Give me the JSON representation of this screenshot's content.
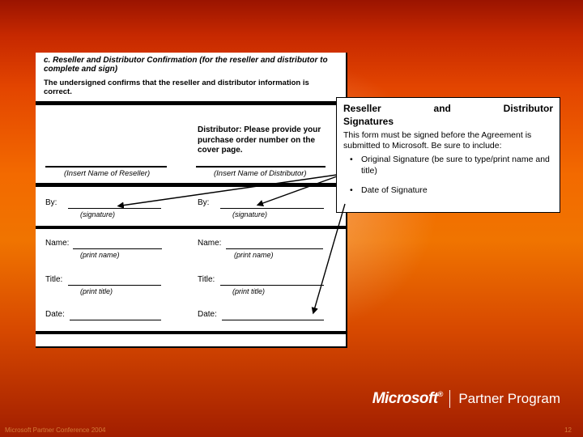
{
  "form": {
    "section_title": "c. Reseller and Distributor Confirmation (for the reseller and distributor to complete and sign)",
    "confirmation_text": "The undersigned confirms that the reseller and distributor information is correct.",
    "distributor_note": "Distributor: Please provide your purchase order number on the cover page.",
    "insert_reseller": "(Insert Name of Reseller)",
    "insert_distributor": "(Insert Name of Distributor)",
    "labels": {
      "by": "By:",
      "name": "Name:",
      "title": "Title:",
      "date": "Date:"
    },
    "hints": {
      "signature": "(signature)",
      "print_name": "(print name)",
      "print_title": "(print title)"
    }
  },
  "callout": {
    "title_line1": "Reseller and Distributor",
    "title_line2": "Signatures",
    "body": "This form must be signed before the Agreement is submitted to Microsoft. Be sure to include:",
    "bullets": [
      "Original Signature (be sure to type/print name and title)",
      "Date of Signature"
    ]
  },
  "branding": {
    "microsoft": "Microsoft",
    "reg": "®",
    "partner_program": "Partner Program"
  },
  "footer": {
    "left": "Microsoft Partner Conference 2004",
    "right": "12"
  }
}
